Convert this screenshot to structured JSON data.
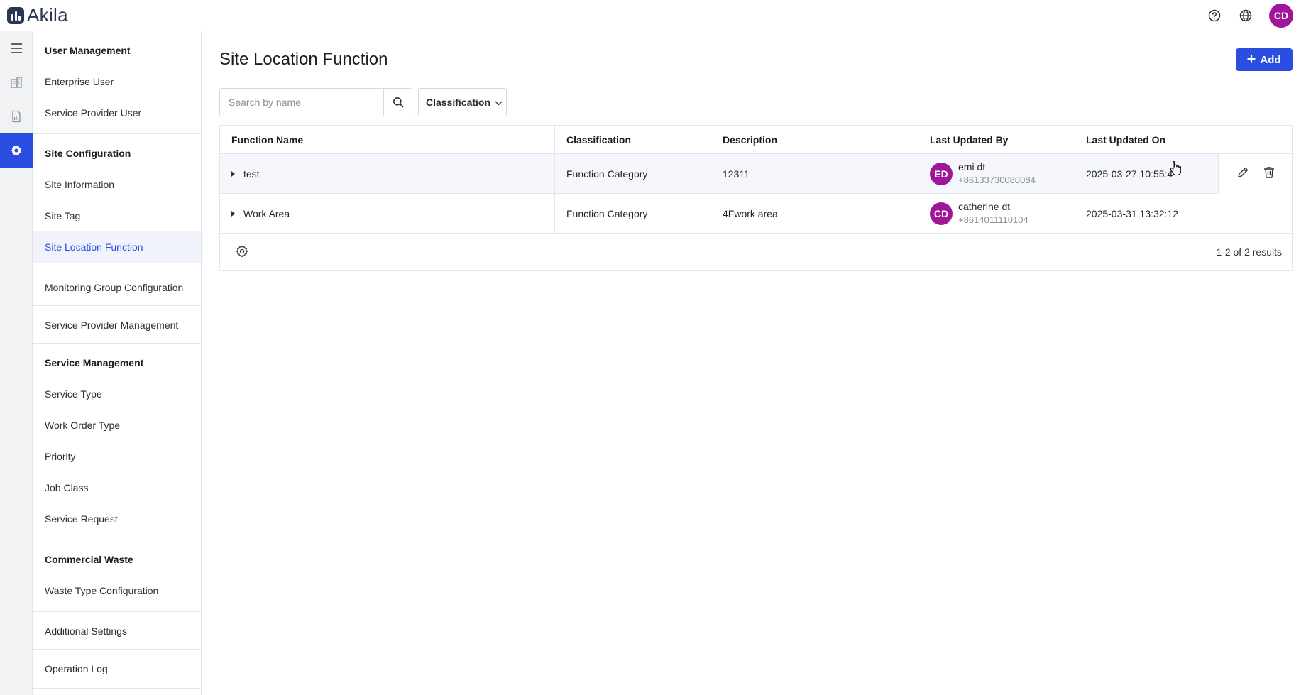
{
  "app": {
    "brand": "Akila",
    "accent": "#2a4fe0",
    "avatar_color": "#a0169a"
  },
  "topbar": {
    "help_icon": "help-circle-icon",
    "language_icon": "globe-icon",
    "user_initials": "CD"
  },
  "rail": {
    "items": [
      "menu-icon",
      "building-icon",
      "report-icon",
      "settings-icon"
    ]
  },
  "sidebar": {
    "user_management": {
      "title": "User Management",
      "items": [
        "Enterprise User",
        "Service Provider User"
      ]
    },
    "site_configuration": {
      "title": "Site Configuration",
      "items": [
        "Site Information",
        "Site Tag",
        "Site Location Function"
      ]
    },
    "monitoring_group": "Monitoring Group Configuration",
    "service_provider_management": "Service Provider Management",
    "service_management": {
      "title": "Service Management",
      "items": [
        "Service Type",
        "Work Order Type",
        "Priority",
        "Job Class",
        "Service Request"
      ]
    },
    "commercial_waste": {
      "title": "Commercial Waste",
      "items": [
        "Waste Type Configuration"
      ]
    },
    "additional_settings": "Additional Settings",
    "operation_log": "Operation Log"
  },
  "page": {
    "title": "Site Location Function",
    "add_label": "Add",
    "search_placeholder": "Search by name",
    "classification_filter": "Classification"
  },
  "table": {
    "columns": [
      "Function Name",
      "Classification",
      "Description",
      "Last Updated By",
      "Last Updated On"
    ],
    "rows": [
      {
        "name": "test",
        "classification": "Function Category",
        "description": "12311",
        "user_initials": "ED",
        "user_name": "emi dt",
        "user_phone": "+86133730080084",
        "updated_on": "2025-03-27 10:55:4"
      },
      {
        "name": "Work Area",
        "classification": "Function Category",
        "description": "4Fwork area",
        "user_initials": "CD",
        "user_name": "catherine dt",
        "user_phone": "+8614011110104",
        "updated_on": "2025-03-31 13:32:12"
      }
    ],
    "results": "1-2 of 2 results"
  }
}
